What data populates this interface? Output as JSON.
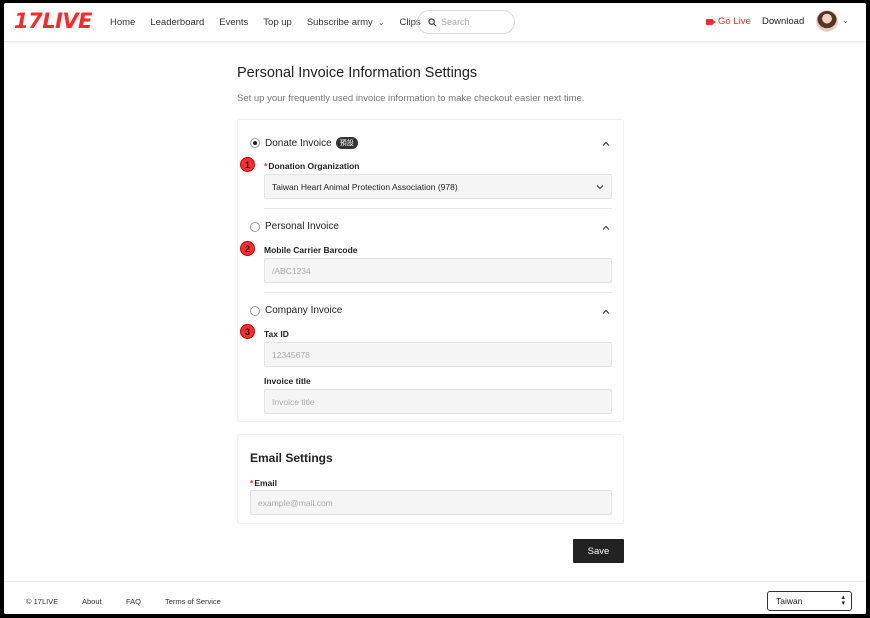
{
  "header": {
    "logo": "17LIVE",
    "nav": [
      {
        "label": "Home"
      },
      {
        "label": "Leaderboard"
      },
      {
        "label": "Events"
      },
      {
        "label": "Top up"
      },
      {
        "label": "Subscribe army",
        "dropdown": true
      },
      {
        "label": "Clips"
      }
    ],
    "search_placeholder": "Search",
    "go_live": "Go Live",
    "download": "Download",
    "accent_color": "#ff2929"
  },
  "page": {
    "title": "Personal Invoice Information Settings",
    "subtitle": "Set up your frequently used invoice information to make checkout easier next time."
  },
  "invoice": {
    "donate": {
      "label": "Donate Invoice",
      "badge": "預設",
      "selected": true,
      "step": "1",
      "field_label": "Donation Organization",
      "required": "*",
      "value": "Taiwan Heart Animal Protection Association (978)"
    },
    "personal": {
      "label": "Personal Invoice",
      "selected": false,
      "step": "2",
      "field_label": "Mobile Carrier Barcode",
      "placeholder": "/ABC1234"
    },
    "company": {
      "label": "Company Invoice",
      "selected": false,
      "step": "3",
      "tax_label": "Tax ID",
      "tax_placeholder": "12345678",
      "title_label": "Invoice title",
      "title_placeholder": "Invoice title"
    }
  },
  "email": {
    "section_title": "Email Settings",
    "required": "*",
    "label": "Email",
    "placeholder": "example@mail.com"
  },
  "save_label": "Save",
  "footer": {
    "copyright": "© 17LIVE",
    "links": [
      "About",
      "FAQ",
      "Terms of Service"
    ],
    "region": "Taiwan"
  }
}
